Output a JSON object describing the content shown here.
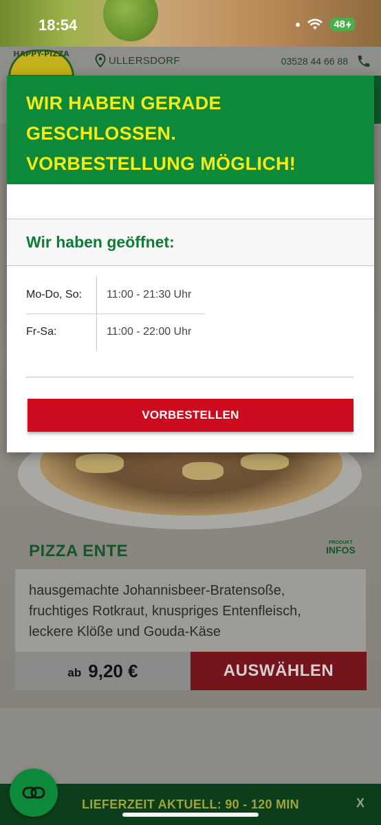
{
  "status_bar": {
    "time": "18:54",
    "battery": "48"
  },
  "header": {
    "logo_text": "HAPPY-PIZZA",
    "location": "ULLERSDORF",
    "phone": "03528 44 66 88"
  },
  "modal": {
    "title_lines": [
      "WIR HABEN GERADE",
      "GESCHLOSSEN.",
      "VORBESTELLUNG MÖGLICH!"
    ],
    "open_title": "Wir haben geöffnet:",
    "hours": [
      {
        "days": "Mo-Do, So:",
        "time": "11:00 - 21:30 Uhr"
      },
      {
        "days": "Fr-Sa:",
        "time": "11:00 - 22:00 Uhr"
      }
    ],
    "preorder_label": "VORBESTELLEN"
  },
  "product": {
    "name": "PIZZA ENTE",
    "infos_small": "PRODUKT",
    "infos_big": "INFOS",
    "description_lines": [
      "hausgemachte Johannisbeer-Bratensoße,",
      "fruchtiges Rotkraut, knuspriges Entenfleisch,",
      "leckere Klöße und Gouda-Käse"
    ],
    "price_prefix": "ab",
    "price": "9,20 €",
    "select_label": "AUSWÄHLEN"
  },
  "bottom_bar": {
    "delivery_text": "LIEFERZEIT AKTUELL: 90 - 120 MIN",
    "close_label": "X"
  },
  "colors": {
    "brand_green": "#0c8a3a",
    "title_yellow": "#f3ec17",
    "button_red": "#cc0b1f"
  }
}
